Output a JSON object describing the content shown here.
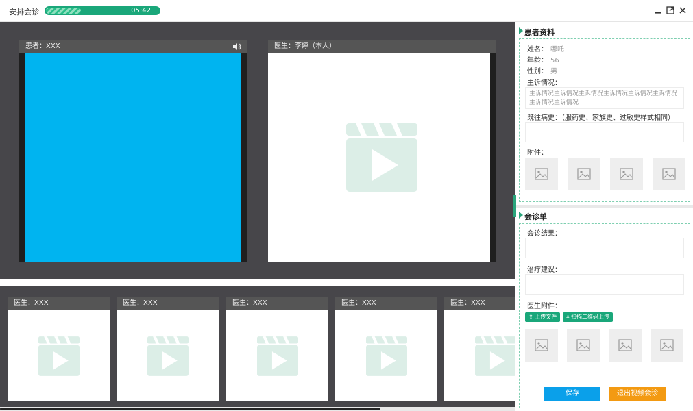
{
  "window": {
    "title": "安排会诊",
    "timer": "05:42",
    "timer_progress_percent": 30,
    "controls": [
      "minimize-icon",
      "maximize-icon",
      "close-icon"
    ]
  },
  "main_videos": [
    {
      "label": "患者：XXX",
      "icon": "speaker-icon",
      "feed_color": "#00b4f0"
    },
    {
      "label": "医生：李婷（本人）"
    }
  ],
  "thumbnails": [
    {
      "label": "医生：XXX"
    },
    {
      "label": "医生：XXX"
    },
    {
      "label": "医生：XXX"
    },
    {
      "label": "医生：XXX"
    },
    {
      "label": "医生：XXX"
    }
  ],
  "patient": {
    "section_title": "患者资料",
    "name_label": "姓名：",
    "name_value": "哪吒",
    "age_label": "年龄：",
    "age_value": "56",
    "gender_label": "性别：",
    "gender_value": "男",
    "complaint_label": "主诉情况：",
    "complaint_text": "主诉情况主诉情况主诉情况主诉情况主诉情况主诉情况主诉情况主诉情况",
    "history_label": "既往病史：（服药史、家族史、过敏史样式相同）",
    "history_text": "",
    "attachments_label": "附件："
  },
  "consult": {
    "section_title": "会诊单",
    "result_label": "会诊结果：",
    "advice_label": "治疗建议：",
    "doctor_attach_label": "医生附件：",
    "upload_label": "上传文件",
    "scan_label": "扫描二维码上传",
    "save_label": "保存",
    "exit_label": "退出视频会诊"
  },
  "colors": {
    "accent": "#1aa77a",
    "save": "#0aa0ea",
    "exit": "#f39a12",
    "stage": "#47464a"
  }
}
